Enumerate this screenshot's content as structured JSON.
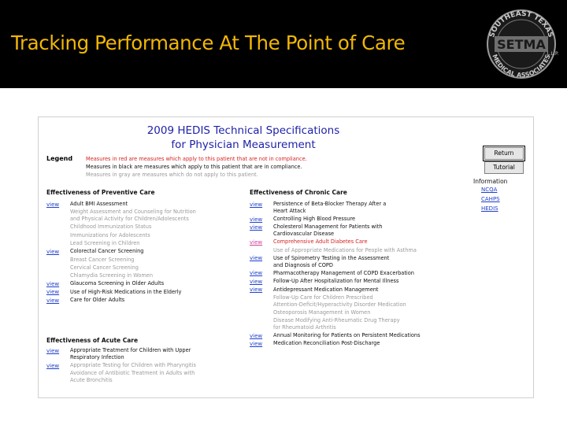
{
  "slide_title": "Tracking Performance At The Point of Care",
  "logo": {
    "top_text": "SOUTHEAST TEXAS",
    "main_text": "SETMA",
    "bottom_text": "MEDICAL ASSOCIATES",
    "suffix": "L.L.P."
  },
  "doc": {
    "title_line1": "2009 HEDIS Technical Specifications",
    "title_line2": "for Physician Measurement",
    "legend_label": "Legend",
    "legend": [
      {
        "text": "Measures in red are measures which apply to this patient that are not in compliance.",
        "color": "red"
      },
      {
        "text": "Measures in black are measures which apply to this patient that are in compliance.",
        "color": "black"
      },
      {
        "text": "Measures in gray are measures which do not apply to this patient.",
        "color": "gray"
      }
    ],
    "buttons": {
      "return": "Return",
      "tutorial": "Tutorial"
    },
    "information": {
      "label": "Information",
      "links": [
        "NCQA",
        "CAHPS",
        "HEDIS"
      ]
    },
    "view_label": "view",
    "preventive": {
      "title": "Effectiveness of Preventive Care",
      "items": [
        {
          "lines": [
            "Adult BMI Assessment"
          ],
          "color": "black",
          "view": true
        },
        {
          "lines": [
            "Weight Assessment and Counseling for Nutrition",
            "and Physical Activity for Children/Adolescents"
          ],
          "color": "gray",
          "view": false
        },
        {
          "lines": [
            "Childhood Immunization Status"
          ],
          "color": "gray",
          "view": false
        },
        {
          "lines": [
            "Immunizations for Adolescents"
          ],
          "color": "gray",
          "view": false
        },
        {
          "lines": [
            "Lead Screening in Children"
          ],
          "color": "gray",
          "view": false
        },
        {
          "lines": [
            "Colorectal Cancer Screening"
          ],
          "color": "black",
          "view": true
        },
        {
          "lines": [
            "Breast Cancer Screening"
          ],
          "color": "gray",
          "view": false
        },
        {
          "lines": [
            "Cervical Cancer Screening"
          ],
          "color": "gray",
          "view": false
        },
        {
          "lines": [
            "Chlamydia Screening in Women"
          ],
          "color": "gray",
          "view": false
        },
        {
          "lines": [
            "Glaucoma Screening in Older Adults"
          ],
          "color": "black",
          "view": true
        },
        {
          "lines": [
            "Use of High-Risk Medications in the Elderly"
          ],
          "color": "black",
          "view": true
        },
        {
          "lines": [
            "Care for Older Adults"
          ],
          "color": "black",
          "view": true
        }
      ]
    },
    "acute": {
      "title": "Effectiveness of Acute Care",
      "items": [
        {
          "lines": [
            "Appropriate Treatment for Children with Upper",
            "Respiratory Infection"
          ],
          "color": "black",
          "view": true
        },
        {
          "lines": [
            "Appropriate Testing for Children with Pharyngitis"
          ],
          "color": "gray",
          "view": true
        },
        {
          "lines": [
            "Avoidance of Antibiotic Treatment in Adults with",
            "Acute Bronchitis"
          ],
          "color": "gray",
          "view": false
        }
      ]
    },
    "chronic": {
      "title": "Effectiveness of Chronic Care",
      "items": [
        {
          "lines": [
            "Persistence of Beta-Blocker Therapy After a",
            "Heart Attack"
          ],
          "color": "black",
          "view": true
        },
        {
          "lines": [
            "Controlling High Blood Pressure"
          ],
          "color": "black",
          "view": true
        },
        {
          "lines": [
            "Cholesterol Management for Patients with",
            "Cardiovascular Disease"
          ],
          "color": "black",
          "view": true
        },
        {
          "lines": [
            "Comprehensive Adult Diabetes Care"
          ],
          "color": "red",
          "view": true,
          "view_color": "pink"
        },
        {
          "lines": [
            "Use of Appropriate Medications for People with Asthma"
          ],
          "color": "gray",
          "view": false
        },
        {
          "lines": [
            "Use of Spirometry Testing in the Assessment",
            "and Diagnosis of COPD"
          ],
          "color": "black",
          "view": true
        },
        {
          "lines": [
            "Pharmacotherapy Management of COPD Exacerbation"
          ],
          "color": "black",
          "view": true
        },
        {
          "lines": [
            "Follow-Up After Hospitalization for Mental Illness"
          ],
          "color": "black",
          "view": true
        },
        {
          "lines": [
            "Antidepressant Medication Management"
          ],
          "color": "black",
          "view": true
        },
        {
          "lines": [
            "Follow-Up Care for Children Prescribed",
            "Attention-Deficit/Hyperactivity Disorder Medication"
          ],
          "color": "gray",
          "view": false
        },
        {
          "lines": [
            "Osteoporosis Management in Women"
          ],
          "color": "gray",
          "view": false
        },
        {
          "lines": [
            "Disease Modifying Anti-Rheumatic Drug Therapy",
            "for Rheumatoid Arthritis"
          ],
          "color": "gray",
          "view": false
        },
        {
          "lines": [
            "Annual Monitoring for Patients on Persistent Medications"
          ],
          "color": "black",
          "view": true
        },
        {
          "lines": [
            "Medication Reconciliation Post-Discharge"
          ],
          "color": "black",
          "view": true
        }
      ]
    }
  }
}
